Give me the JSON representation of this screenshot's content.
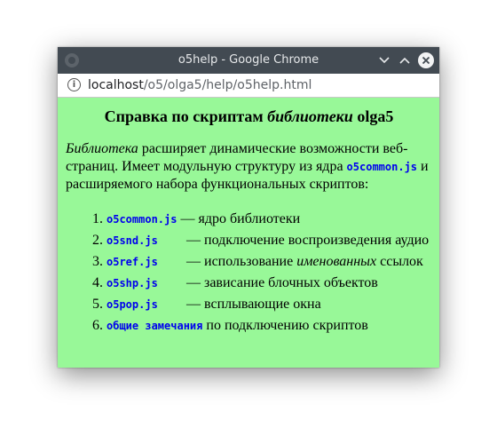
{
  "window": {
    "title": "o5help - Google Chrome"
  },
  "address_bar": {
    "host": "localhost",
    "path": "/o5/olga5/help/o5help.html"
  },
  "page": {
    "heading_prefix": "Справка по скриптам ",
    "heading_em": "библиотеки",
    "heading_suffix": " olga5",
    "intro_em": "Библиотека",
    "intro_text1": " расширяет динамические возможности веб-страниц. Имеет модульную структуру из ядра ",
    "intro_code": "o5common.js",
    "intro_text2": " и расширяемого набора функциональных скриптов:",
    "items": [
      {
        "code": "o5common.js",
        "text": " — ядро библиотеки"
      },
      {
        "code": "o5snd.js",
        "text": " — подключение воспроизведения аудио"
      },
      {
        "code": "o5ref.js",
        "text_before": " — использование ",
        "text_em": "именованных",
        "text_after": " ссылок"
      },
      {
        "code": "o5shp.js",
        "text": " — зависание блочных объектов"
      },
      {
        "code": "o5pop.js",
        "text": " — всплывающие окна"
      },
      {
        "code": "общие замечания",
        "text": " по подключению скриптов"
      }
    ]
  }
}
